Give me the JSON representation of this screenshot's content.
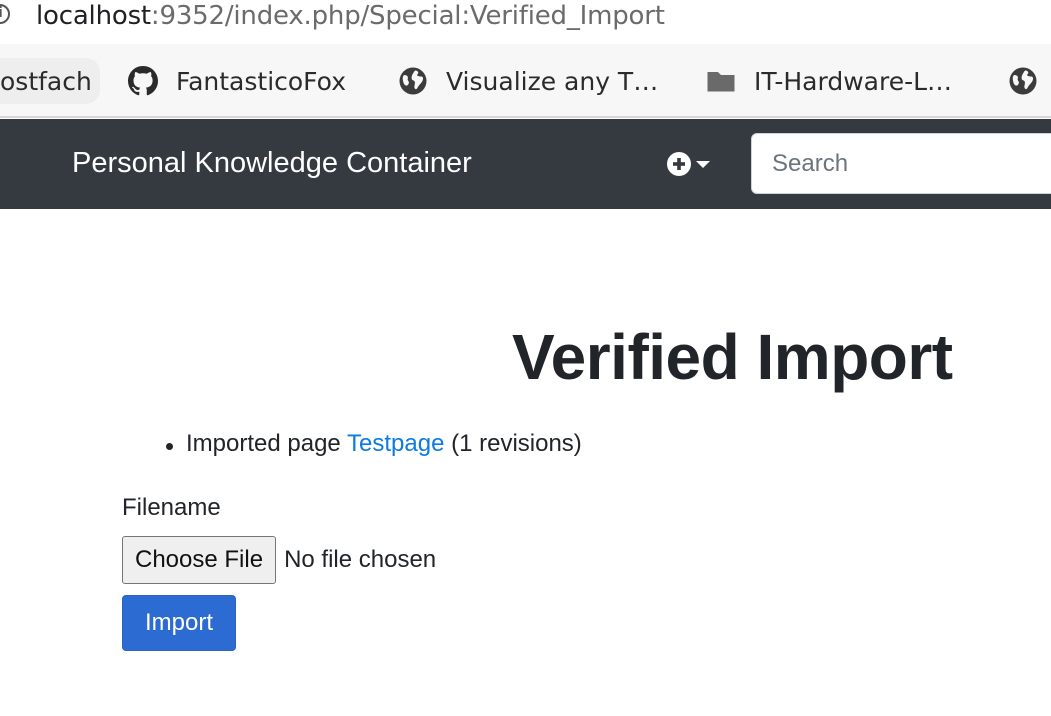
{
  "browser": {
    "url_host": "localhost",
    "url_rest": ":9352/index.php/Special:Verified_Import",
    "bookmarks": [
      {
        "label": "ostfach",
        "icon": "none"
      },
      {
        "label": "FantasticoFox",
        "icon": "github-icon"
      },
      {
        "label": "Visualize any T…",
        "icon": "globe-icon"
      },
      {
        "label": "IT-Hardware-L…",
        "icon": "folder-icon"
      },
      {
        "label": "",
        "icon": "globe-icon"
      }
    ]
  },
  "navbar": {
    "brand": "Personal Knowledge Container",
    "add_menu_icon": "plus-circle-icon",
    "search_placeholder": "Search",
    "background_color": "#343a40"
  },
  "main": {
    "title": "Verified Import",
    "results": [
      {
        "prefix": "Imported page ",
        "link": "Testpage",
        "suffix": " (1 revisions)"
      }
    ],
    "form": {
      "filename_label": "Filename",
      "choose_file_label": "Choose File",
      "no_file_text": "No file chosen",
      "import_label": "Import"
    }
  },
  "colors": {
    "link": "#0d7be0",
    "primary_button": "#2c6bd1"
  }
}
